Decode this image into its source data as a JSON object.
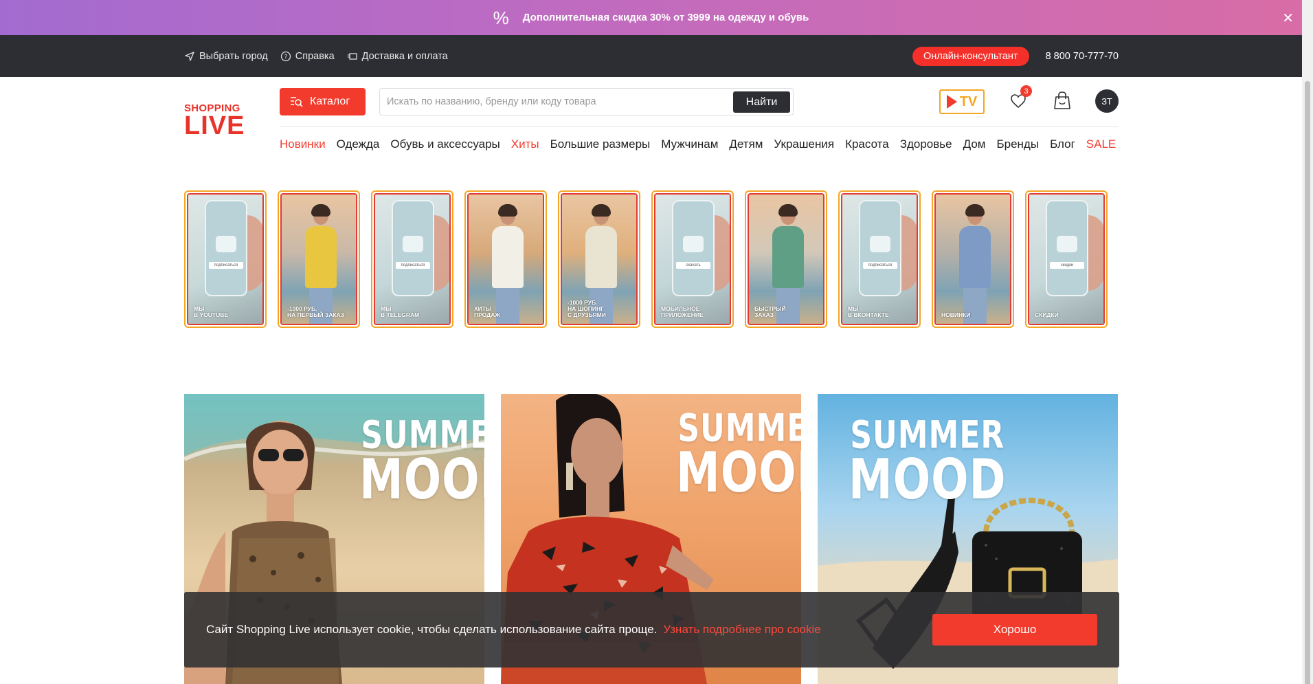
{
  "promo": {
    "icon": "percent-icon",
    "text": "Дополнительная скидка 30% от 3999 на одежду и обувь",
    "close_icon": "close-icon"
  },
  "topbar": {
    "city": "Выбрать город",
    "help": "Справка",
    "delivery": "Доставка и оплата",
    "consultant": "Онлайн-консультант",
    "phone": "8 800 70-777-70"
  },
  "header": {
    "logo_top": "SHOPPING",
    "logo_bottom": "LIVE",
    "catalog": "Каталог",
    "search_placeholder": "Искать по названию, бренду или коду товара",
    "search_button": "Найти",
    "tv_label": "TV",
    "favorites_count": "3",
    "avatar_initials": "ЗТ"
  },
  "nav": [
    {
      "label": "Новинки",
      "accent": true
    },
    {
      "label": "Одежда",
      "accent": false
    },
    {
      "label": "Обувь и аксессуары",
      "accent": false
    },
    {
      "label": "Хиты",
      "accent": true
    },
    {
      "label": "Большие размеры",
      "accent": false
    },
    {
      "label": "Мужчинам",
      "accent": false
    },
    {
      "label": "Детям",
      "accent": false
    },
    {
      "label": "Украшения",
      "accent": false
    },
    {
      "label": "Красота",
      "accent": false
    },
    {
      "label": "Здоровье",
      "accent": false
    },
    {
      "label": "Дом",
      "accent": false
    },
    {
      "label": "Бренды",
      "accent": false
    },
    {
      "label": "Блог",
      "accent": false
    },
    {
      "label": "SALE",
      "accent": true
    }
  ],
  "stories": [
    {
      "type": "phone",
      "label": "Мы\nв YouTube",
      "icon": "youtube-icon",
      "button": "подписаться"
    },
    {
      "type": "person",
      "label": "-1000 руб.\nна первый заказ",
      "cloth": "#e8c640"
    },
    {
      "type": "phone",
      "label": "Мы\nв Telegram",
      "icon": "telegram-icon",
      "button": "подписаться"
    },
    {
      "type": "person",
      "label": "Хиты\nпродаж",
      "cloth": "#f2efe6"
    },
    {
      "type": "person",
      "label": "-1000 руб.\nна шопинг\nс друзьями",
      "cloth": "#e9e3d2"
    },
    {
      "type": "phone",
      "label": "Мобильное\nприложение",
      "icon": "app-icon",
      "button": "скачать"
    },
    {
      "type": "person",
      "label": "Быстрый\nзаказ",
      "cloth": "#5f9f86"
    },
    {
      "type": "phone",
      "label": "Мы\nв ВКонтакте",
      "icon": "vk-icon",
      "button": "подписаться"
    },
    {
      "type": "person",
      "label": "Новинки",
      "cloth": "#7d9bc4"
    },
    {
      "type": "phone",
      "label": "Скидки",
      "icon": "percent-icon",
      "button": "скидки"
    }
  ],
  "banners": [
    {
      "line1": "SUMMER",
      "line2": "MOOD"
    },
    {
      "line1": "SUMMER",
      "line2": "MOOD"
    },
    {
      "line1": "SUMMER",
      "line2": "MOOD"
    }
  ],
  "cookie": {
    "text": "Сайт Shopping Live использует cookie, чтобы сделать использование сайта проще.",
    "link": "Узнать подробнее про cookie",
    "button": "Хорошо"
  },
  "colors": {
    "accent": "#f23b2d",
    "dark": "#2c2e33",
    "story_border": "#f5a623"
  }
}
